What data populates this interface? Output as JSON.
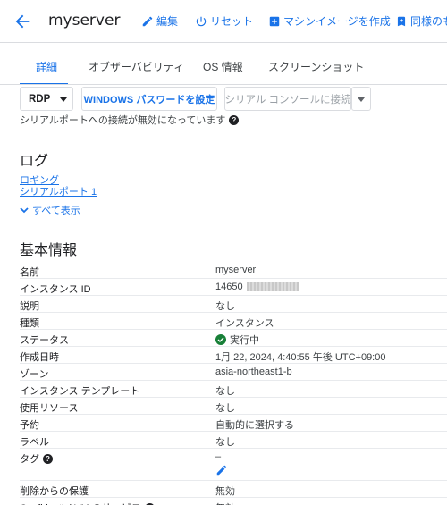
{
  "header": {
    "title": "myserver",
    "actions": [
      {
        "label": "編集",
        "icon": "pencil-icon"
      },
      {
        "label": "リセット",
        "icon": "power-icon"
      },
      {
        "label": "マシンイメージを作成",
        "icon": "add-box-icon"
      },
      {
        "label": "同様のもの",
        "icon": "bookmark-add-icon"
      }
    ]
  },
  "tabs": [
    "詳細",
    "オブザーバビリティ",
    "OS 情報",
    "スクリーンショット"
  ],
  "toolbar": {
    "rdp_label": "RDP",
    "windows_password_label": "WINDOWS パスワードを設定",
    "serial_console_label": "シリアル コンソールに接続"
  },
  "serial_note": "シリアルポートへの接続が無効になっています",
  "logs": {
    "heading": "ログ",
    "links": [
      "ロギング",
      "シリアルポート 1"
    ],
    "show_all": "すべて表示"
  },
  "basic_info": {
    "heading": "基本情報",
    "rows": [
      {
        "key": "名前",
        "value": "myserver"
      },
      {
        "key": "インスタンス ID",
        "value": "14650"
      },
      {
        "key": "説明",
        "value": "なし"
      },
      {
        "key": "種類",
        "value": "インスタンス"
      },
      {
        "key": "ステータス",
        "value": "実行中"
      },
      {
        "key": "作成日時",
        "value": "1月 22, 2024, 4:40:55 午後 UTC+09:00"
      },
      {
        "key": "ゾーン",
        "value": "asia-northeast1-b"
      },
      {
        "key": "インスタンス テンプレート",
        "value": "なし"
      },
      {
        "key": "使用リソース",
        "value": "なし"
      },
      {
        "key": "予約",
        "value": "自動的に選択する"
      },
      {
        "key": "ラベル",
        "value": "なし"
      },
      {
        "key": "タグ",
        "value": "–"
      },
      {
        "key": "削除からの保護",
        "value": "無効"
      },
      {
        "key": "Confidential VM のサービス",
        "value": "無効"
      }
    ]
  },
  "colors": {
    "accent": "#1a73e8",
    "status_ok": "#188038"
  }
}
